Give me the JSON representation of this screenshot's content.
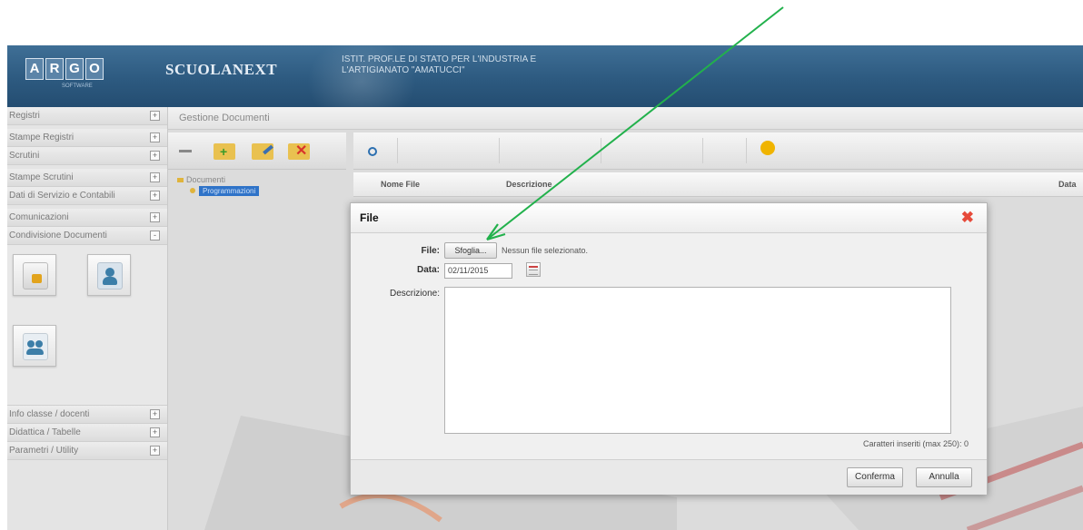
{
  "header": {
    "logo_letters": [
      "A",
      "R",
      "G",
      "O"
    ],
    "logo_sub": "SOFTWARE",
    "app_name": "SCUOLANEXT",
    "school_line1": "ISTIT. PROF.LE DI STATO PER L'INDUSTRIA E",
    "school_line2": "L'ARTIGIANATO \"AMATUCCI\""
  },
  "sidebar": {
    "items_top": [
      {
        "label": "Registri",
        "toggle": "+"
      },
      {
        "label": "Stampe Registri",
        "toggle": "+"
      },
      {
        "label": "Scrutini",
        "toggle": "+"
      },
      {
        "label": "Stampe Scrutini",
        "toggle": "+"
      },
      {
        "label": "Dati di Servizio e Contabili",
        "toggle": "+"
      },
      {
        "label": "Comunicazioni",
        "toggle": "+"
      },
      {
        "label": "Condivisione Documenti",
        "toggle": "-"
      }
    ],
    "items_bottom": [
      {
        "label": "Info classe / docenti",
        "toggle": "+"
      },
      {
        "label": "Didattica / Tabelle",
        "toggle": "+"
      },
      {
        "label": "Parametri / Utility",
        "toggle": "+"
      }
    ]
  },
  "main": {
    "title": "Gestione Documenti",
    "tree_root": "Documenti",
    "tree_child": "Programmazioni",
    "columns": [
      "Nome File",
      "Descrizione",
      "Data"
    ]
  },
  "dialog": {
    "title": "File",
    "close_symbol": "✖",
    "file_label": "File:",
    "choose_button": "Sfoglia...",
    "no_file": "Nessun file selezionato.",
    "date_label": "Data:",
    "date_value": "02/11/2015",
    "description_label": "Descrizione:",
    "char_count": "Caratteri inseriti (max 250): 0",
    "confirm_button": "Conferma",
    "cancel_button": "Annulla"
  },
  "colors": {
    "header_blue": "#2d5a80",
    "selection_blue": "#2f73c8",
    "close_red": "#e64a3a",
    "annotation_arrow": "#22b14c"
  }
}
